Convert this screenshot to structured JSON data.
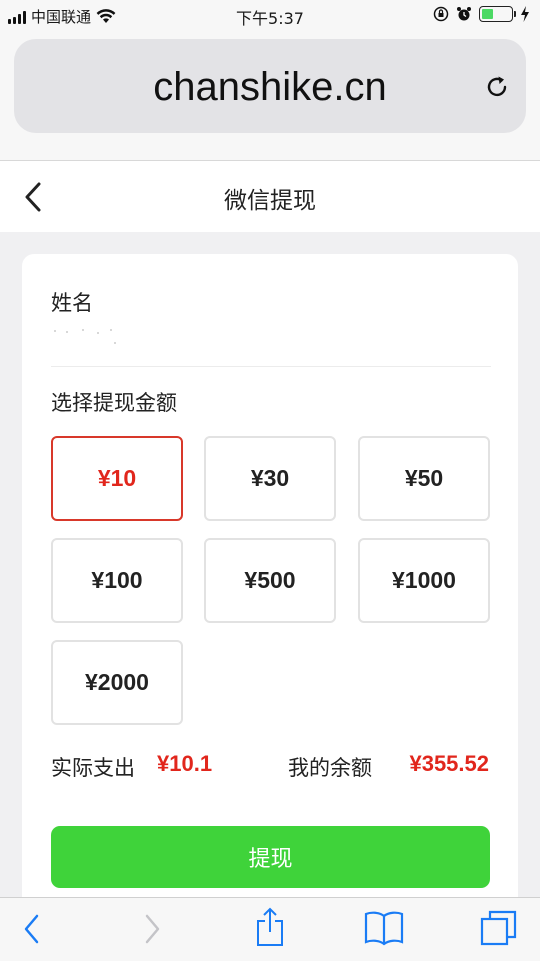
{
  "status_bar": {
    "carrier": "中国联通",
    "time": "下午5:37"
  },
  "browser": {
    "url": "chanshike.cn"
  },
  "page": {
    "title": "微信提现",
    "name_label": "姓名",
    "select_label": "选择提现金额",
    "amounts": [
      "¥10",
      "¥30",
      "¥50",
      "¥100",
      "¥500",
      "¥1000",
      "¥2000"
    ],
    "selected_amount": "¥10",
    "actual_label": "实际支出",
    "actual_value": "¥10.1",
    "balance_label": "我的余额",
    "balance_value": "¥355.52",
    "withdraw_button": "提现"
  },
  "colors": {
    "accent_red": "#e1261c",
    "button_green": "#3fd33a",
    "browser_tint": "#1a7cf5"
  },
  "icons": [
    "wifi-icon",
    "orientation-lock-icon",
    "alarm-icon",
    "battery-icon",
    "charging-icon",
    "reload-icon",
    "back-chevron-icon",
    "browser-back-icon",
    "browser-forward-icon",
    "share-icon",
    "bookmarks-icon",
    "tabs-icon"
  ]
}
